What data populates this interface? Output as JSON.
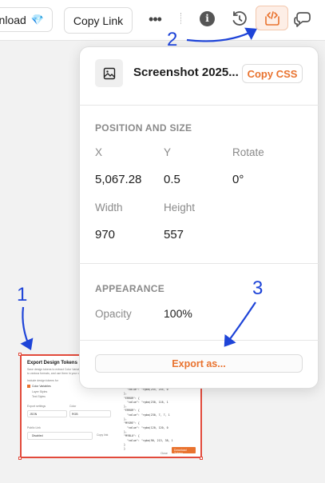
{
  "toolbar": {
    "download_label": "nload",
    "download_emoji": "💎",
    "copy_link_label": "Copy Link",
    "more_glyph": "•••",
    "info_glyph": "i",
    "icons": [
      "more-icon",
      "info-icon",
      "history-icon",
      "code-icon",
      "comments-icon"
    ]
  },
  "panel": {
    "file_name": "Screenshot 2025...",
    "copy_css_label": "Copy CSS",
    "position": {
      "title": "POSITION AND SIZE",
      "x_label": "X",
      "y_label": "Y",
      "rotate_label": "Rotate",
      "x_value": "5,067.28",
      "y_value": "0.5",
      "rotate_value": "0°",
      "width_label": "Width",
      "height_label": "Height",
      "width_value": "970",
      "height_value": "557"
    },
    "appearance": {
      "title": "APPEARANCE",
      "opacity_label": "Opacity",
      "opacity_value": "100%"
    },
    "export_label": "Export as..."
  },
  "annotations": [
    "1",
    "2",
    "3"
  ],
  "thumbnail": {
    "title": "Export Design Tokens",
    "desc1": "Save design tokens to extract Color Variables",
    "desc2": "to various formats, and use them in your code",
    "include_label": "Include design tokens for",
    "opt1": "Color Variables",
    "opt2": "Layer Styles",
    "opt3": "Text Styles",
    "export_settings": "Export settings",
    "color_label": "Color",
    "format_value": "JSON",
    "color_value": "RGB",
    "public_link": "Public Link",
    "disabled_value": "Disabled",
    "copy_link_small": "Copy link",
    "close_label": "Close",
    "download_tokens": "Download Tokens",
    "code": "  \"value\": \"rgba(255, 255, 0\n},\n\"ERROR\": {\n  \"value\": \"rgba(230, 116, 1\n},\n\"ERROR\": {\n  \"value\": \"rgba(230, 7, 7, 1\n},\n\"MYGRE\": {\n  \"value\": \"rgba(120, 120, 0\n},\n\"MYBLU\": {\n  \"value\": \"rgba(90, 213, 38, 1\n}\n}"
  },
  "colors": {
    "accent": "#e9732f",
    "annotation": "#1e44d8",
    "frame": "#e24a3b"
  }
}
